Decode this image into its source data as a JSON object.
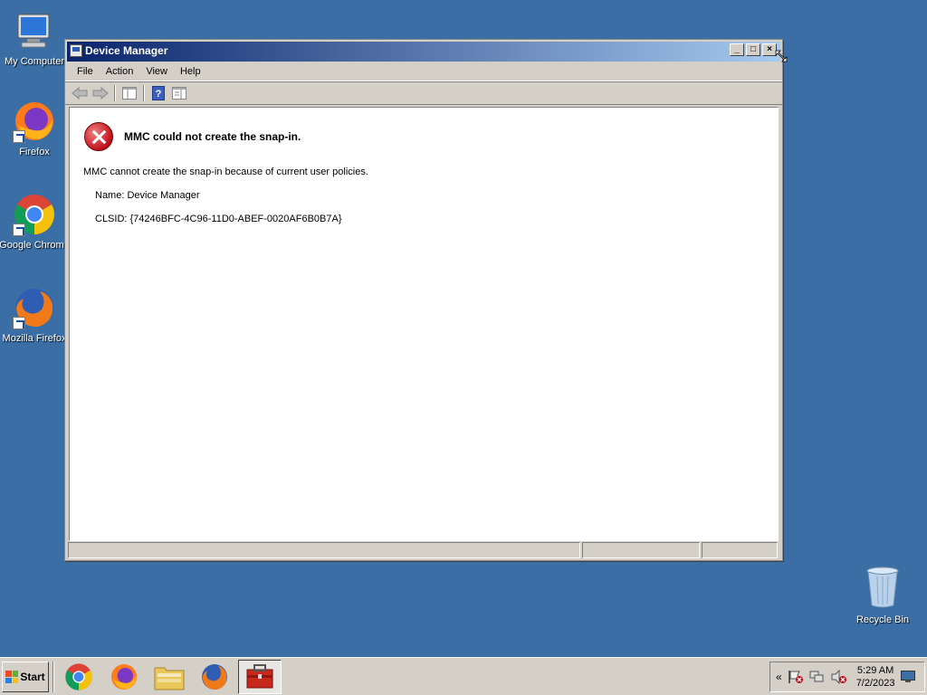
{
  "desktop": {
    "icons": [
      {
        "label": "My Computer"
      },
      {
        "label": "Firefox"
      },
      {
        "label": "Google Chrome"
      },
      {
        "label": "Mozilla Firefox"
      }
    ],
    "recycle_bin": "Recycle Bin"
  },
  "window": {
    "title": "Device Manager",
    "controls": {
      "minimize": "_",
      "maximize": "□",
      "close": "×"
    },
    "menu": [
      "File",
      "Action",
      "View",
      "Help"
    ],
    "toolbar_icons": [
      "back-arrow-icon",
      "forward-arrow-icon",
      "show-hide-console-tree-icon",
      "help-icon",
      "properties-icon"
    ]
  },
  "error": {
    "title": "MMC could not create the snap-in.",
    "message": "MMC cannot create the snap-in because of current user policies.",
    "name_line": "Name: Device Manager",
    "clsid_line": "CLSID: {74246BFC-4C96-11D0-ABEF-0020AF6B0B7A}"
  },
  "taskbar": {
    "start_label": "Start",
    "apps": [
      "google-chrome",
      "firefox",
      "file-explorer",
      "mozilla-firefox",
      "device-manager"
    ],
    "tray": {
      "chevron": "«",
      "time": "5:29 AM",
      "date": "7/2/2023"
    }
  },
  "colors": {
    "desktop": "#3a6ea5",
    "title_start": "#0a246a",
    "title_end": "#a6caf0",
    "error_red": "#c0101a"
  }
}
